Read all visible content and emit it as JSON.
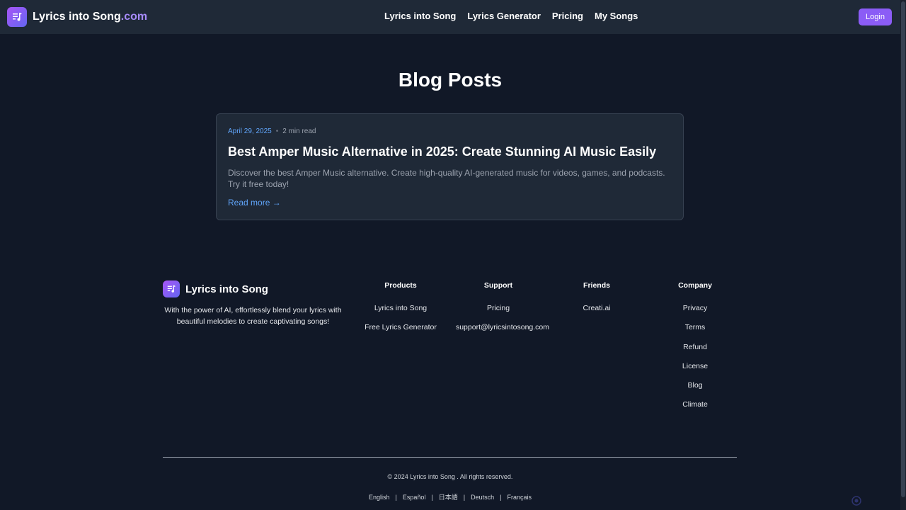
{
  "header": {
    "logo_text": "Lyrics into Song",
    "logo_suffix": ".com",
    "nav": [
      "Lyrics into Song",
      "Lyrics Generator",
      "Pricing",
      "My Songs"
    ],
    "login_label": "Login",
    "accent_color": "#8b5cf6"
  },
  "main": {
    "title": "Blog Posts",
    "posts": [
      {
        "date": "April 29, 2025",
        "read_time": "2 min read",
        "title": "Best Amper Music Alternative in 2025: Create Stunning AI Music Easily",
        "excerpt": "Discover the best Amper Music alternative. Create high-quality AI-generated music for videos, games, and podcasts. Try it free today!",
        "read_more": "Read more →"
      }
    ]
  },
  "footer": {
    "brand_name": "Lyrics into Song",
    "description": "With the power of AI, effortlessly blend your lyrics with beautiful melodies to create captivating songs!",
    "columns": [
      {
        "heading": "Products",
        "links": [
          "Lyrics into Song",
          "Free Lyrics Generator"
        ]
      },
      {
        "heading": "Support",
        "links": [
          "Pricing",
          "support@lyricsintosong.com"
        ]
      },
      {
        "heading": "Friends",
        "links": [
          "Creati.ai"
        ]
      },
      {
        "heading": "Company",
        "links": [
          "Privacy",
          "Terms",
          "Refund",
          "License",
          "Blog",
          "Climate"
        ]
      }
    ],
    "copyright": "© 2024 Lyrics into Song . All rights reserved.",
    "languages": [
      "English",
      "Español",
      "日本語",
      "Deutsch",
      "Français"
    ]
  }
}
